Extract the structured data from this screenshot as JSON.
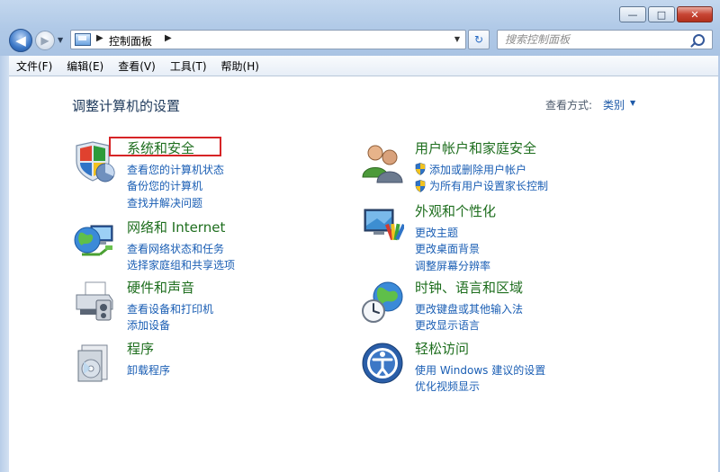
{
  "window": {
    "minimize_glyph": "—",
    "maximize_glyph": "□",
    "close_glyph": "✕"
  },
  "nav": {
    "back_glyph": "◀",
    "forward_glyph": "▶",
    "dropdown_glyph": "▼",
    "breadcrumb_sep": "▶",
    "address_text": "控制面板",
    "refresh_glyph": "↻",
    "search_placeholder": "搜索控制面板"
  },
  "menu": {
    "items": [
      "文件(F)",
      "编辑(E)",
      "查看(V)",
      "工具(T)",
      "帮助(H)"
    ]
  },
  "page": {
    "title": "调整计算机的设置",
    "view_by_label": "查看方式:",
    "view_by_value": "类别",
    "view_drop_glyph": "▼"
  },
  "categories": [
    {
      "title": "系统和安全",
      "icon": "shield-icon",
      "links": [
        "查看您的计算机状态",
        "备份您的计算机",
        "查找并解决问题"
      ]
    },
    {
      "title": "网络和 Internet",
      "icon": "network-globe-icon",
      "links": [
        "查看网络状态和任务",
        "选择家庭组和共享选项"
      ]
    },
    {
      "title": "硬件和声音",
      "icon": "printer-icon",
      "links": [
        "查看设备和打印机",
        "添加设备"
      ]
    },
    {
      "title": "程序",
      "icon": "programs-icon",
      "links": [
        "卸载程序"
      ]
    },
    {
      "title": "用户帐户和家庭安全",
      "icon": "users-icon",
      "links": [
        "添加或删除用户帐户",
        "为所有用户设置家长控制"
      ]
    },
    {
      "title": "外观和个性化",
      "icon": "monitor-paint-icon",
      "links": [
        "更改主题",
        "更改桌面背景",
        "调整屏幕分辨率"
      ]
    },
    {
      "title": "时钟、语言和区域",
      "icon": "clock-globe-icon",
      "links": [
        "更改键盘或其他输入法",
        "更改显示语言"
      ]
    },
    {
      "title": "轻松访问",
      "icon": "ease-of-access-icon",
      "links": [
        "使用 Windows 建议的设置",
        "优化视频显示"
      ]
    }
  ],
  "colors": {
    "link": "#1a5eb4",
    "category_title": "#1e6e1e",
    "highlight": "#d62426",
    "frame": "#b0c9e7"
  }
}
